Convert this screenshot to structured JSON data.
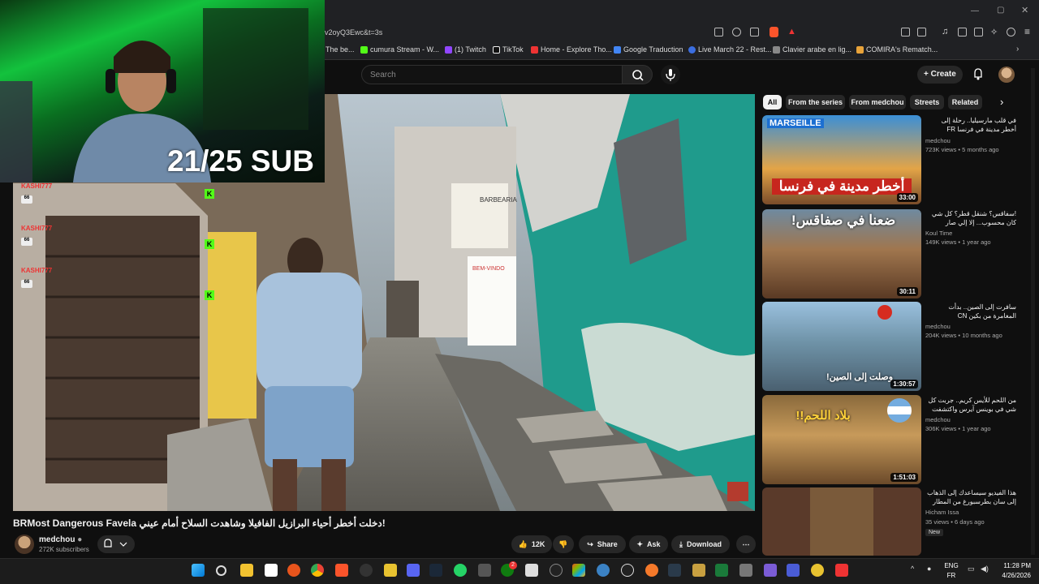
{
  "browser": {
    "url": "v2oyQ3Ewc&t=3s",
    "bookmarks": [
      "The be...",
      "cumura Stream - W...",
      "(1) Twitch",
      "TikTok",
      "Home - Explore Tho...",
      "Google Traduction",
      "Live March 22 - Rest...",
      "Clavier arabe en lig...",
      "COMIRA's Rematch..."
    ]
  },
  "header": {
    "search_placeholder": "Search",
    "create_label": "Create"
  },
  "overlay": {
    "sub_goal": "21/25 SUB",
    "chat_names": [
      "KASHI777",
      "KASHI777",
      "KASHI777"
    ],
    "badge": "66"
  },
  "video": {
    "title": "BRMost Dangerous Favela دخلت أخطر أحياء البرازيل الفافيلا وشاهدت السلاح أمام عيني!",
    "channel": "medchou",
    "subscribers": "272K subscribers",
    "likes": "12K",
    "share_label": "Share",
    "ask_label": "Ask",
    "download_label": "Download",
    "sign_texts": [
      "BARBEARIA",
      "BEM-VINDO"
    ]
  },
  "chips": [
    "All",
    "From the series",
    "From medchou",
    "Streets",
    "Related"
  ],
  "related": [
    {
      "title": "في قلب مارسيليا.. رحلة إلى أخطر مدينة في فرنسا FR",
      "channel": "medchou",
      "meta": "723K views • 5 months ago",
      "duration": "33:00",
      "overlay": "أخطر مدينة في فرنسا",
      "tag": "MARSEILLE"
    },
    {
      "title": "!سفاقس؟ شنقل قطر؟ كل شي كان محسوب... إلا إلي صار",
      "channel": "Koul Time",
      "meta": "149K views • 1 year ago",
      "duration": "30:11",
      "overlay": "ضعنا في صفاقس!"
    },
    {
      "title": "سافرت إلى الصين.. بدأت المغامرة من بكين CN",
      "channel": "medchou",
      "meta": "204K views • 10 months ago",
      "duration": "1:30:57",
      "overlay": "وصلت إلى الصين!"
    },
    {
      "title": "من اللحم للأيس كريم.. جربت كل شي في بوينس آيرس واكتشفت مدينة تعيش بالأكل",
      "channel": "medchou",
      "meta": "306K views • 1 year ago",
      "duration": "1:51:03",
      "overlay": "بلاد اللحم!!"
    },
    {
      "title": "هذا الفيديو سيساعدك إلى الذهاب إلى سان بطرسبورغ من المطار دون مساعدة أحد المقلة",
      "channel": "Hicham Issa",
      "meta": "35 views • 6 days ago",
      "badge": "New"
    }
  ],
  "taskbar": {
    "lang": "ENG",
    "lang2": "FR",
    "time": "11:28 PM",
    "date": "4/26/2026",
    "notif_count": "2"
  },
  "colors": {
    "background": "#0f0f0f",
    "kick_green": "#53fc18",
    "chip_active": "#f1f1f1"
  }
}
